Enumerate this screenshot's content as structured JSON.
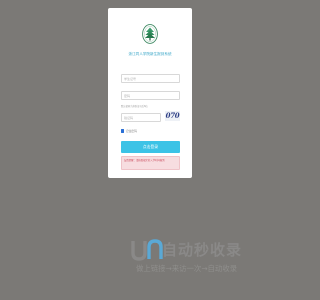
{
  "login": {
    "title": "浙江同人学院新生报到系统",
    "username_placeholder": "学生证号",
    "password_placeholder": "密码",
    "password_hint": "默认密码为身份证号后6位",
    "captcha_placeholder": "验证码",
    "captcha_code": "070",
    "remember_label": "记住密码",
    "remember_checked": true,
    "submit_label": "点击登录",
    "notice": "友情提醒：请按照规定的入学时间报到"
  },
  "watermark": {
    "title": "自动秒收录",
    "subtitle": "做上链接→来访一次→自动收录"
  },
  "colors": {
    "background": "#7b7976",
    "accent": "#3cc3e6",
    "notice_bg": "#f7dde0",
    "notice_text": "#c9485a"
  },
  "icons": {
    "logo": "school-emblem-icon",
    "watermark": "wm-logo-icon"
  }
}
